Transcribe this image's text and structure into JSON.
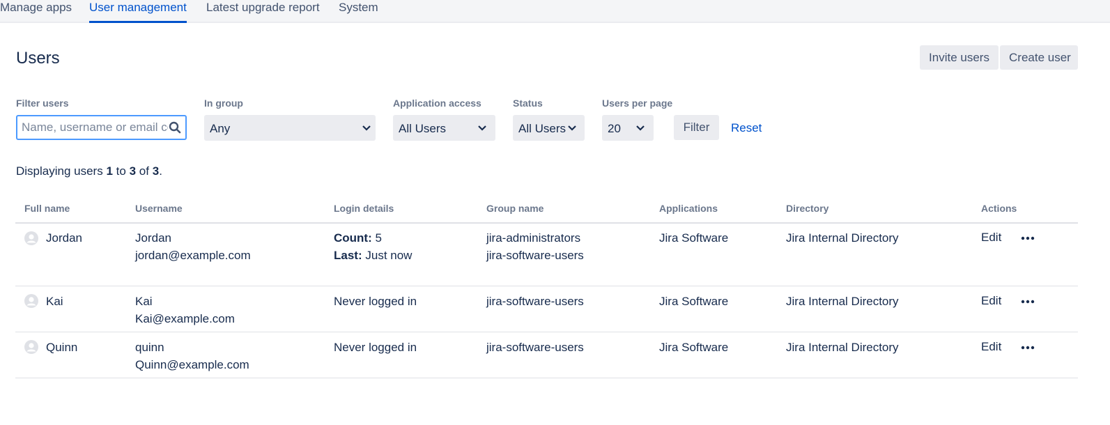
{
  "tabs": [
    {
      "label": "Manage apps"
    },
    {
      "label": "User management"
    },
    {
      "label": "Latest upgrade report"
    },
    {
      "label": "System"
    }
  ],
  "page_title": "Users",
  "header_buttons": {
    "invite": "Invite users",
    "create": "Create user"
  },
  "filters": {
    "filter_users": {
      "label": "Filter users",
      "placeholder": "Name, username or email contains"
    },
    "in_group": {
      "label": "In group",
      "value": "Any"
    },
    "application_access": {
      "label": "Application access",
      "value": "All Users"
    },
    "status": {
      "label": "Status",
      "value": "All Users"
    },
    "users_per_page": {
      "label": "Users per page",
      "value": "20"
    },
    "filter_button": "Filter",
    "reset_link": "Reset"
  },
  "summary": {
    "prefix": "Displaying users",
    "from": "1",
    "to_word": "to",
    "to": "3",
    "of_word": "of",
    "total": "3",
    "suffix": "."
  },
  "table": {
    "headers": [
      "Full name",
      "Username",
      "Login details",
      "Group name",
      "Applications",
      "Directory",
      "Actions"
    ],
    "rows": [
      {
        "full_name": "Jordan",
        "username": "Jordan",
        "email": "jordan@example.com",
        "count_label": "Count:",
        "count_value": "5",
        "last_label": "Last:",
        "last_value": "Just now",
        "groups": [
          "jira-administrators",
          "jira-software-users"
        ],
        "application": "Jira Software",
        "directory": "Jira Internal Directory",
        "edit": "Edit"
      },
      {
        "full_name": "Kai",
        "username": "Kai",
        "email": "Kai@example.com",
        "login": "Never logged in",
        "groups": [
          "jira-software-users"
        ],
        "application": "Jira Software",
        "directory": "Jira Internal Directory",
        "edit": "Edit"
      },
      {
        "full_name": "Quinn",
        "username": "quinn",
        "email": "Quinn@example.com",
        "login": "Never logged in",
        "groups": [
          "jira-software-users"
        ],
        "application": "Jira Software",
        "directory": "Jira Internal Directory",
        "edit": "Edit"
      }
    ]
  },
  "colors": {
    "link": "#0052cc",
    "focus_border": "#4c9aff",
    "button_bg": "#ebecf0",
    "header_text": "#6b778c"
  },
  "icons": [
    "search-icon",
    "chevron-down-icon",
    "avatar-icon",
    "more-icon"
  ]
}
